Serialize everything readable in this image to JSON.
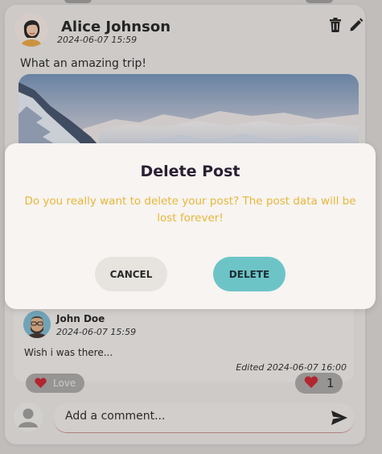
{
  "post": {
    "author": "Alice Johnson",
    "timestamp": "2024-06-07 15:59",
    "text": "What an amazing trip!"
  },
  "comment": {
    "author": "John Doe",
    "timestamp": "2024-06-07 15:59",
    "text": "Wish i was there...",
    "edited": "Edited 2024-06-07 16:00"
  },
  "reactions": {
    "love_label": "Love",
    "count": "1"
  },
  "new_comment": {
    "placeholder": "Add a comment..."
  },
  "dialog": {
    "title": "Delete Post",
    "message": "Do you really want to delete your post? The post data will be lost forever!",
    "cancel_label": "CANCEL",
    "delete_label": "DELETE"
  },
  "icons": {
    "trash": "trash-icon",
    "edit": "pencil-icon",
    "heart": "heart-icon",
    "send": "send-icon",
    "user": "user-icon"
  },
  "colors": {
    "dialog_message": "#e8b63a",
    "delete_button": "#6dc4c6",
    "cancel_button": "#e7e3df",
    "heart": "#c81e2a"
  }
}
